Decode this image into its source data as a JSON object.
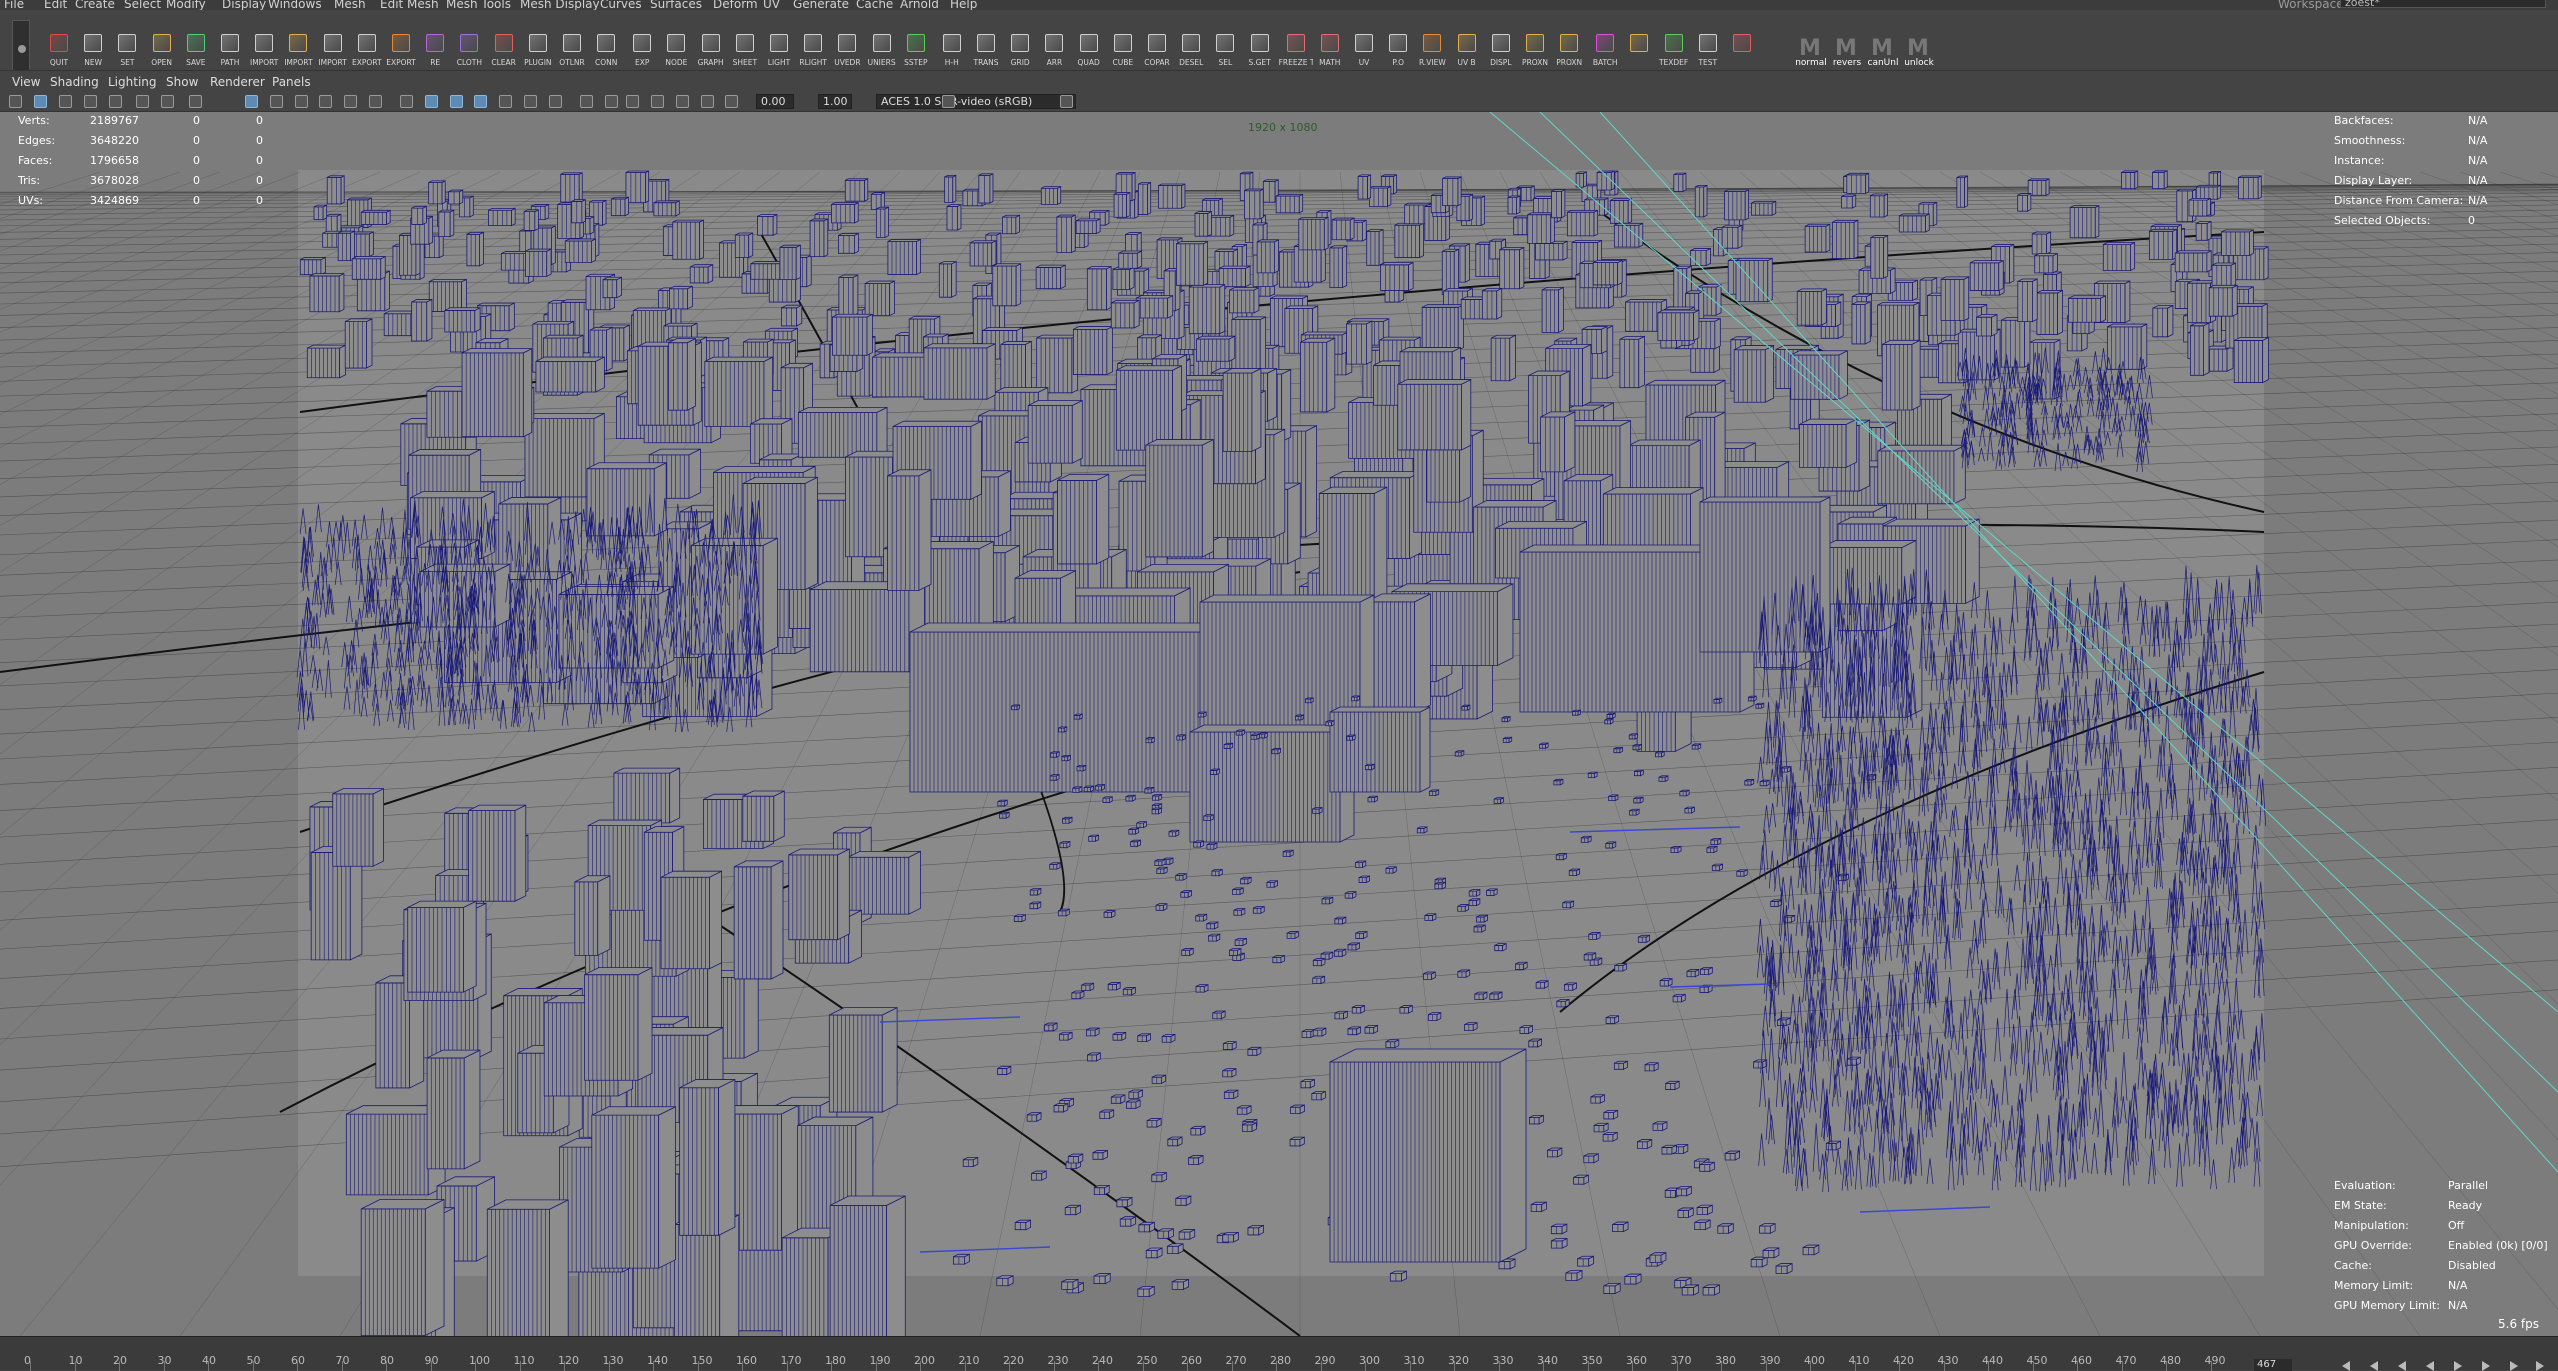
{
  "menu": {
    "items": [
      "File",
      "Edit",
      "Create",
      "Select",
      "Modify",
      "Display",
      "Windows",
      "Mesh",
      "Edit Mesh",
      "Mesh Tools",
      "Mesh Display",
      "Curves",
      "Surfaces",
      "Deform",
      "UV",
      "Generate",
      "Cache",
      "Arnold",
      "Help"
    ],
    "workspace_label": "Workspace:",
    "workspace_value": "zoest*"
  },
  "shelf": {
    "buttons": [
      {
        "label": "QUIT",
        "icon": "quit-icon",
        "color": "#d84c4c"
      },
      {
        "label": "NEW",
        "icon": "new-file-icon",
        "color": "#cfcfcf"
      },
      {
        "label": "SET",
        "icon": "set-project-icon",
        "color": "#cfcfcf"
      },
      {
        "label": "OPEN",
        "icon": "open-folder-icon",
        "color": "#e0b050"
      },
      {
        "label": "SAVE",
        "icon": "save-icon",
        "color": "#4fd07a"
      },
      {
        "label": "PATH",
        "icon": "path-icon",
        "color": "#cfcfcf"
      },
      {
        "label": "IMPORT",
        "icon": "import-icon",
        "color": "#cfcfcf"
      },
      {
        "label": "IMPORT",
        "icon": "import-icon",
        "color": "#e0b050"
      },
      {
        "label": "IMPORT",
        "icon": "import-icon",
        "color": "#cfcfcf"
      },
      {
        "label": "EXPORT",
        "icon": "export-icon",
        "color": "#cfcfcf"
      },
      {
        "label": "EXPORT",
        "icon": "export-icon",
        "color": "#e08a3a"
      },
      {
        "label": "RE",
        "icon": "reference-icon",
        "color": "#b06ad8"
      },
      {
        "label": "CLOTH",
        "icon": "cloth-icon",
        "color": "#a070e0"
      },
      {
        "label": "CLEAR",
        "icon": "clear-icon",
        "color": "#e06060"
      },
      {
        "label": "PLUGIN",
        "icon": "plugin-icon",
        "color": "#cfcfcf"
      },
      {
        "label": "OTLNR",
        "icon": "outliner-icon",
        "color": "#cfcfcf"
      },
      {
        "label": "CONN",
        "icon": "connection-icon",
        "color": "#cfcfcf"
      },
      {
        "label": "EXP",
        "icon": "expression-icon",
        "color": "#cfcfcf"
      },
      {
        "label": "NODE",
        "icon": "node-editor-icon",
        "color": "#cfcfcf"
      },
      {
        "label": "GRAPH",
        "icon": "graph-icon",
        "color": "#cfcfcf"
      },
      {
        "label": "SHEET",
        "icon": "sheet-icon",
        "color": "#cfcfcf"
      },
      {
        "label": "LIGHT",
        "icon": "light-editor-icon",
        "color": "#cfcfcf"
      },
      {
        "label": "RLIGHT",
        "icon": "render-light-icon",
        "color": "#cfcfcf"
      },
      {
        "label": "UVEDR",
        "icon": "uv-editor-icon",
        "color": "#cfcfcf"
      },
      {
        "label": "UNIERS",
        "icon": "universe-icon",
        "color": "#cfcfcf"
      },
      {
        "label": "SSTEP",
        "icon": "step-icon",
        "color": "#57d05a"
      },
      {
        "label": "H-H",
        "icon": "history-icon",
        "color": "#cfcfcf"
      },
      {
        "label": "TRANS",
        "icon": "transform-icon",
        "color": "#cfcfcf"
      },
      {
        "label": "GRID",
        "icon": "grid-icon",
        "color": "#cfcfcf"
      },
      {
        "label": "ARR",
        "icon": "array-icon",
        "color": "#cfcfcf"
      },
      {
        "label": "QUAD",
        "icon": "quad-icon",
        "color": "#cfcfcf"
      },
      {
        "label": "CUBE",
        "icon": "cube-icon",
        "color": "#cfcfcf"
      },
      {
        "label": "COPAR",
        "icon": "copy-icon",
        "color": "#cfcfcf"
      },
      {
        "label": "DESEL",
        "icon": "deselect-icon",
        "color": "#cfcfcf"
      },
      {
        "label": "SEL",
        "icon": "select-icon",
        "color": "#cfcfcf"
      },
      {
        "label": "S.GET",
        "icon": "select-get-icon",
        "color": "#cfcfcf"
      },
      {
        "label": "FREEZE\nTRANS",
        "icon": "freeze-icon",
        "color": "#e07070"
      },
      {
        "label": "MATH",
        "icon": "math-icon",
        "color": "#e07070"
      },
      {
        "label": "UV",
        "icon": "uv-icon",
        "color": "#cfcfcf"
      },
      {
        "label": "P.O",
        "icon": "polygon-icon",
        "color": "#cfcfcf"
      },
      {
        "label": "R.VIEW",
        "icon": "render-view-icon",
        "color": "#e08a3a"
      },
      {
        "label": "UV B",
        "icon": "uv-bake-icon",
        "color": "#e0b050"
      },
      {
        "label": "DISPL",
        "icon": "display-icon",
        "color": "#cfcfcf"
      },
      {
        "label": "PROXN",
        "icon": "proxy-icon",
        "color": "#e0b050"
      },
      {
        "label": "PROXN",
        "icon": "proxy-icon",
        "color": "#e0b050"
      },
      {
        "label": "BATCH",
        "icon": "batch-icon",
        "color": "#e050e0"
      },
      {
        "label": "",
        "icon": "face-icon",
        "color": "#e0b050"
      },
      {
        "label": "TEXDEF",
        "icon": "texture-icon",
        "color": "#57d05a"
      },
      {
        "label": "TEST",
        "icon": "test-icon",
        "color": "#cfcfcf"
      },
      {
        "label": "",
        "icon": "playblast-icon",
        "color": "#e06060"
      }
    ],
    "mel_buttons": [
      "normal",
      "revers",
      "canUnl",
      "unlock"
    ]
  },
  "panel_menu": [
    "View",
    "Shading",
    "Lighting",
    "Show",
    "Renderer",
    "Panels"
  ],
  "panel_toolbar": {
    "exposure": "0.00",
    "gamma": "1.00",
    "color_space": "ACES 1.0 SDR-video (sRGB)"
  },
  "hud_left": [
    {
      "label": "Verts:",
      "a": "2189767",
      "b": "0",
      "c": "0"
    },
    {
      "label": "Edges:",
      "a": "3648220",
      "b": "0",
      "c": "0"
    },
    {
      "label": "Faces:",
      "a": "1796658",
      "b": "0",
      "c": "0"
    },
    {
      "label": "Tris:",
      "a": "3678028",
      "b": "0",
      "c": "0"
    },
    {
      "label": "UVs:",
      "a": "3424869",
      "b": "0",
      "c": "0"
    }
  ],
  "hud_right": [
    {
      "label": "Backfaces:",
      "value": "N/A"
    },
    {
      "label": "Smoothness:",
      "value": "N/A"
    },
    {
      "label": "Instance:",
      "value": "N/A"
    },
    {
      "label": "Display Layer:",
      "value": "N/A"
    },
    {
      "label": "Distance From Camera:",
      "value": "N/A"
    },
    {
      "label": "Selected Objects:",
      "value": "0"
    }
  ],
  "resolution_gate": "1920 x 1080",
  "hud_eval": [
    {
      "label": "Evaluation:",
      "value": "Parallel"
    },
    {
      "label": "EM State:",
      "value": "Ready"
    },
    {
      "label": "Manipulation:",
      "value": "Off"
    },
    {
      "label": "GPU Override:",
      "value": "Enabled (0k) [0/0]"
    },
    {
      "label": "Cache:",
      "value": "Disabled"
    },
    {
      "label": "Memory Limit:",
      "value": "N/A"
    },
    {
      "label": "GPU Memory Limit:",
      "value": "N/A"
    }
  ],
  "fps": "5.6 fps",
  "timeline": {
    "ticks": [
      "0",
      "10",
      "20",
      "30",
      "40",
      "50",
      "60",
      "70",
      "80",
      "90",
      "100",
      "110",
      "120",
      "130",
      "140",
      "150",
      "160",
      "170",
      "180",
      "190",
      "200",
      "210",
      "220",
      "230",
      "240",
      "250",
      "260",
      "270",
      "280",
      "290",
      "300",
      "310",
      "320",
      "330",
      "340",
      "350",
      "360",
      "370",
      "380",
      "390",
      "400",
      "410",
      "420",
      "430",
      "440",
      "450",
      "460",
      "470",
      "480",
      "490"
    ],
    "current_frame": "467"
  },
  "colors": {
    "wire": "#1a1a78",
    "ground": "#878787",
    "accent": "#5d8bb5"
  }
}
